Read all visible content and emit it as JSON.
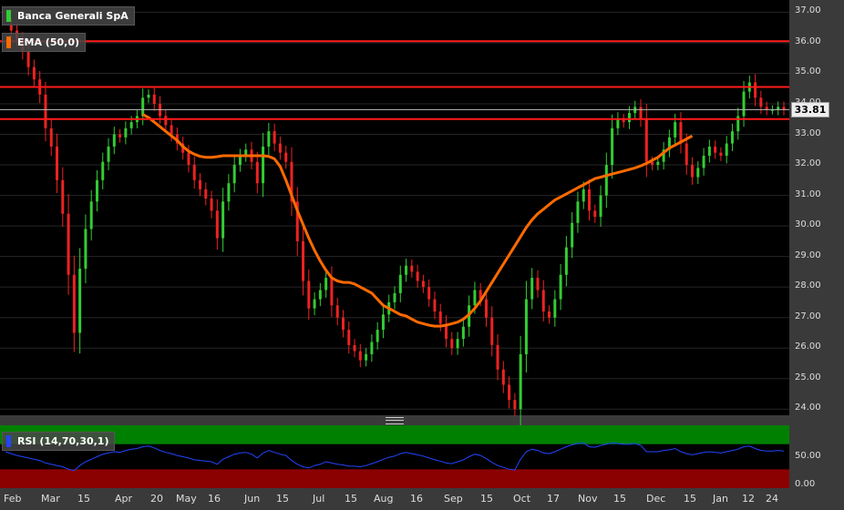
{
  "header": {
    "instrument_title": "Banca Generali SpA",
    "ema_label": "EMA (50,0)",
    "rsi_label": "RSI (14,70,30,1)"
  },
  "price_tag": "33.81",
  "colors": {
    "background": "#000000",
    "frame": "#3a3a3a",
    "up_candle": "#33cc33",
    "down_candle": "#ee2222",
    "ema_line": "#ff6a00",
    "resistance_line": "#ff1a1a",
    "rsi_line": "#2244ff",
    "rsi_overbought_zone": "#008000",
    "rsi_oversold_zone": "#8b0000"
  },
  "y_ticks": [
    "37.00",
    "36.00",
    "35.00",
    "34.00",
    "33.00",
    "32.00",
    "31.00",
    "30.00",
    "29.00",
    "28.00",
    "27.00",
    "26.00",
    "25.00",
    "24.00"
  ],
  "rsi_ticks": [
    "50.00",
    "0.00"
  ],
  "x_ticks": [
    "Feb",
    "Mar",
    "15",
    "Apr",
    "20",
    "May",
    "16",
    "Jun",
    "15",
    "Jul",
    "15",
    "Aug",
    "16",
    "Sep",
    "15",
    "Oct",
    "17",
    "Nov",
    "15",
    "Dec",
    "15",
    "Jan",
    "12",
    "24"
  ],
  "chart_data": {
    "type": "candlestick",
    "title": "Banca Generali SpA",
    "ylim": [
      23.8,
      37.4
    ],
    "x_tick_labels": [
      "Feb",
      "Mar",
      "15",
      "Apr",
      "20",
      "May",
      "16",
      "Jun",
      "15",
      "Jul",
      "15",
      "Aug",
      "16",
      "Sep",
      "15",
      "Oct",
      "17",
      "Nov",
      "15",
      "Dec",
      "15",
      "Jan",
      "12",
      "24"
    ],
    "horizontal_levels": [
      36.05,
      34.55,
      33.5
    ],
    "last_price": 33.81,
    "close_series": [
      36.6,
      36.4,
      36.1,
      35.7,
      35.2,
      34.8,
      34.3,
      33.2,
      32.6,
      31.5,
      30.4,
      28.4,
      26.5,
      28.6,
      29.9,
      30.8,
      31.5,
      32.1,
      32.6,
      33.0,
      32.9,
      33.2,
      33.4,
      33.6,
      34.2,
      34.3,
      34.0,
      33.6,
      33.3,
      33.0,
      32.7,
      32.4,
      32.0,
      31.5,
      31.2,
      30.9,
      30.5,
      29.6,
      30.8,
      31.4,
      32.0,
      32.3,
      32.5,
      32.1,
      31.4,
      32.6,
      33.1,
      32.7,
      32.4,
      32.1,
      30.8,
      29.5,
      28.2,
      27.3,
      27.6,
      27.9,
      28.3,
      27.4,
      27.0,
      26.6,
      26.1,
      25.9,
      25.6,
      25.8,
      26.2,
      26.6,
      27.1,
      27.5,
      27.8,
      28.4,
      28.7,
      28.5,
      28.2,
      28.0,
      27.6,
      27.2,
      26.8,
      26.3,
      26.0,
      26.3,
      26.7,
      27.4,
      27.9,
      27.6,
      27.0,
      26.1,
      25.3,
      24.8,
      24.3,
      24.0,
      25.8,
      27.6,
      28.3,
      27.9,
      27.2,
      27.0,
      27.6,
      28.4,
      29.3,
      30.1,
      30.8,
      31.2,
      30.5,
      30.3,
      31.0,
      32.0,
      33.2,
      33.5,
      33.4,
      33.7,
      33.9,
      33.5,
      32.1,
      32.0,
      32.1,
      32.5,
      32.9,
      33.4,
      32.7,
      32.0,
      31.6,
      31.9,
      32.3,
      32.6,
      32.4,
      32.3,
      32.7,
      33.1,
      33.6,
      34.4,
      34.7,
      34.2,
      33.9,
      33.8,
      33.8,
      33.9,
      33.8
    ],
    "ema_series": [
      null,
      null,
      null,
      null,
      null,
      null,
      null,
      null,
      null,
      null,
      null,
      null,
      null,
      null,
      null,
      null,
      null,
      null,
      null,
      null,
      null,
      null,
      null,
      null,
      33.65,
      33.55,
      33.4,
      33.25,
      33.1,
      32.95,
      32.8,
      32.6,
      32.45,
      32.35,
      32.28,
      32.25,
      32.25,
      32.27,
      32.3,
      32.3,
      32.3,
      32.3,
      32.3,
      32.3,
      32.3,
      32.3,
      32.28,
      32.2,
      31.95,
      31.5,
      31.0,
      30.5,
      30.05,
      29.6,
      29.2,
      28.85,
      28.55,
      28.3,
      28.2,
      28.15,
      28.15,
      28.1,
      28.0,
      27.9,
      27.8,
      27.6,
      27.4,
      27.3,
      27.2,
      27.1,
      27.05,
      26.95,
      26.85,
      26.8,
      26.75,
      26.72,
      26.72,
      26.75,
      26.8,
      26.85,
      26.95,
      27.1,
      27.3,
      27.55,
      27.85,
      28.15,
      28.45,
      28.75,
      29.05,
      29.35,
      29.65,
      29.95,
      30.2,
      30.4,
      30.55,
      30.7,
      30.85,
      30.95,
      31.05,
      31.15,
      31.25,
      31.35,
      31.45,
      31.55,
      31.6,
      31.65,
      31.7,
      31.75,
      31.8,
      31.85,
      31.9,
      31.97,
      32.05,
      32.15,
      32.25,
      32.4,
      32.55,
      32.65,
      32.75,
      32.85,
      32.95
    ],
    "rsi_ylim": [
      0,
      100
    ],
    "rsi_levels": [
      30,
      70
    ],
    "rsi_series": [
      58,
      55,
      52,
      50,
      48,
      46,
      44,
      40,
      38,
      36,
      34,
      30,
      28,
      36,
      42,
      46,
      50,
      54,
      56,
      58,
      57,
      60,
      62,
      63,
      66,
      67,
      64,
      60,
      57,
      55,
      52,
      50,
      48,
      45,
      44,
      43,
      42,
      38,
      46,
      50,
      54,
      56,
      57,
      54,
      48,
      56,
      60,
      57,
      54,
      52,
      44,
      38,
      34,
      32,
      36,
      38,
      42,
      40,
      38,
      37,
      35,
      35,
      34,
      36,
      39,
      42,
      46,
      49,
      51,
      55,
      57,
      55,
      53,
      51,
      48,
      45,
      43,
      40,
      39,
      42,
      45,
      50,
      54,
      52,
      47,
      41,
      36,
      33,
      30,
      29,
      46,
      58,
      62,
      60,
      56,
      55,
      58,
      62,
      66,
      69,
      71,
      72,
      66,
      65,
      68,
      70,
      72,
      71,
      70,
      70,
      71,
      68,
      58,
      58,
      58,
      60,
      61,
      63,
      58,
      55,
      53,
      55,
      57,
      58,
      57,
      56,
      58,
      60,
      62,
      66,
      67,
      63,
      60,
      59,
      59,
      60,
      59
    ]
  }
}
